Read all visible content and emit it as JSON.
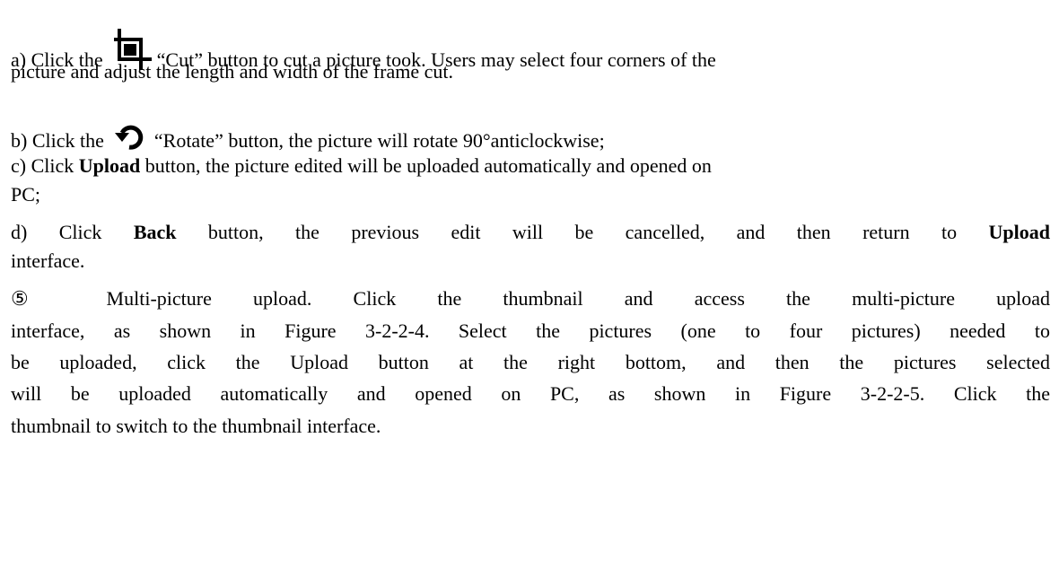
{
  "item_a": {
    "prefix": "a) Click the",
    "icon": "crop-icon",
    "rest_line1": "“Cut” button to cut a picture took. Users may select four corners of the",
    "line2": "picture and adjust the length and width of the frame cut."
  },
  "item_b": {
    "prefix": "b) Click the",
    "icon": "rotate-icon",
    "rest": "“Rotate” button, the picture will rotate 90°anticlockwise;"
  },
  "item_c": {
    "prefix": "c) Click",
    "bold": "Upload",
    "rest_line1": "button, the picture edited will be uploaded automatically and opened on",
    "line2": "PC;"
  },
  "item_d": {
    "prefix": "d) Click",
    "bold1": "Back",
    "middle": "button, the previous edit will be cancelled, and then return to",
    "bold2": "Upload",
    "line2": "interface."
  },
  "item_5": {
    "line1": "⑤ Multi-picture upload. Click the thumbnail and access the multi-picture upload",
    "line2": "interface, as shown in Figure 3-2-2-4. Select the pictures (one to four pictures) needed to",
    "line3": "be uploaded, click the Upload button at the right bottom, and then the pictures selected",
    "line4": "will be uploaded automatically and opened on PC, as shown in Figure 3-2-2-5. Click the",
    "line5": "thumbnail to switch to the thumbnail interface."
  }
}
